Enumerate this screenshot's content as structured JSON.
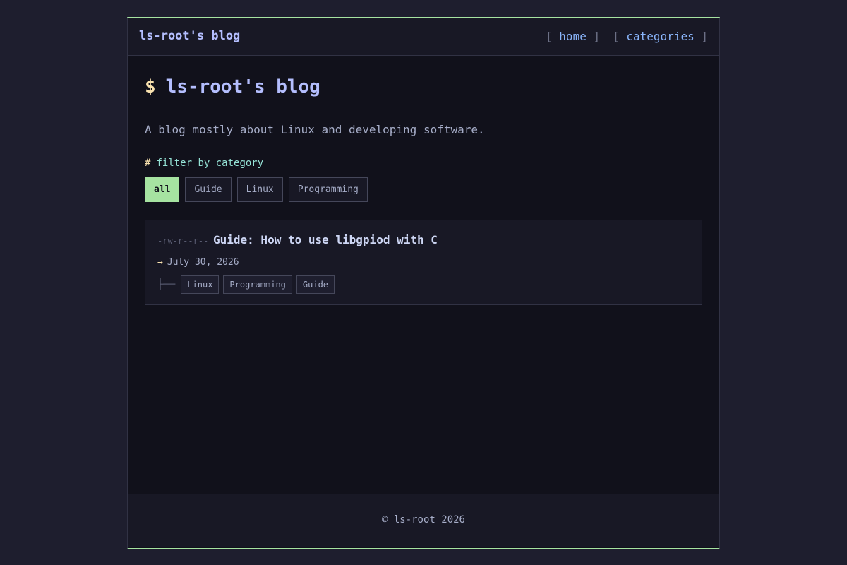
{
  "header": {
    "site_name": "ls-root's blog",
    "nav": [
      {
        "open": "[",
        "label": "home",
        "close": "]"
      },
      {
        "open": "[",
        "label": "categories",
        "close": "]"
      }
    ]
  },
  "main": {
    "title_prompt": "$",
    "title": "ls-root's blog",
    "subtitle": "A blog mostly about Linux and developing software.",
    "filter_heading_prefix": "#",
    "filter_heading": "filter by category",
    "filters": [
      {
        "label": "all",
        "active": true
      },
      {
        "label": "Guide",
        "active": false
      },
      {
        "label": "Linux",
        "active": false
      },
      {
        "label": "Programming",
        "active": false
      }
    ],
    "posts": [
      {
        "perms": "-rw-r--r--",
        "title": "Guide: How to use libgpiod with C",
        "date_arrow": "→",
        "date": "July 30, 2026",
        "tree": "├──",
        "tags": [
          "Linux",
          "Programming",
          "Guide"
        ]
      }
    ]
  },
  "footer": {
    "copyright": "© ls-root 2026"
  },
  "colors": {
    "background": "#1e1e2e",
    "panel": "#11111b",
    "accent_green": "#a6e3a1",
    "title_lavender": "#b4befe",
    "link_blue": "#89b4fa",
    "prompt_yellow": "#f9e2af",
    "heading_teal": "#94e2d5"
  }
}
